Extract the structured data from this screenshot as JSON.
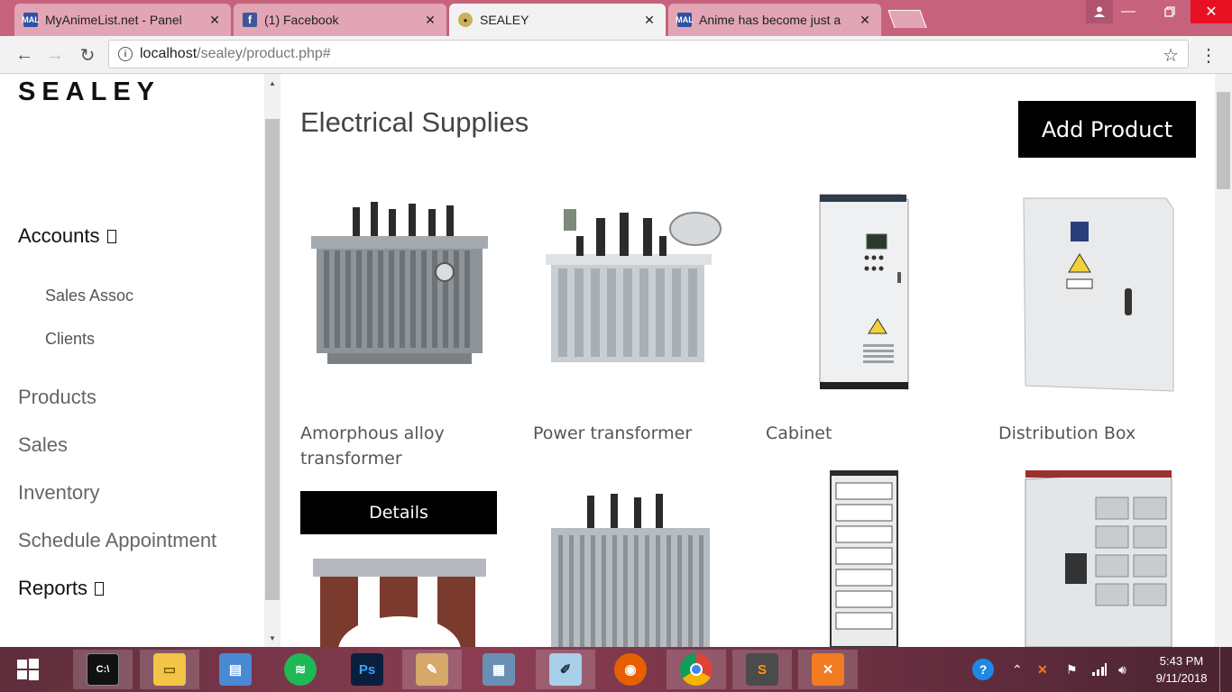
{
  "browser": {
    "tabs": [
      {
        "title": "MyAnimeList.net - Panel",
        "favicon": "mal-icon",
        "active": false
      },
      {
        "title": "(1) Facebook",
        "favicon": "facebook-icon",
        "active": false
      },
      {
        "title": "SEALEY",
        "favicon": "sealey-icon",
        "active": true
      },
      {
        "title": "Anime has become just a",
        "favicon": "mal-icon",
        "active": false
      }
    ],
    "tab_close_glyph": "✕",
    "url_host": "localhost",
    "url_path": "/sealey/product.php#"
  },
  "sidebar": {
    "brand": "SEALEY",
    "accounts": "Accounts",
    "sub_items": [
      "Sales Assoc",
      "Clients"
    ],
    "products": "Products",
    "sales": "Sales",
    "inventory": "Inventory",
    "schedule": "Schedule Appointment",
    "reports": "Reports"
  },
  "main": {
    "title": "Electrical Supplies",
    "add_button": "Add Product",
    "details_button": "Details",
    "products": [
      {
        "name": "Amorphous alloy transformer",
        "image": "transformer-icon"
      },
      {
        "name": "Power transformer",
        "image": "transformer-icon"
      },
      {
        "name": "Cabinet",
        "image": "cabinet-icon"
      },
      {
        "name": "Distribution Box",
        "image": "distribution-box-icon"
      }
    ]
  },
  "taskbar": {
    "time": "5:43 PM",
    "date": "9/11/2018"
  },
  "colors": {
    "tabstrip": "#c7627d",
    "button": "#000000",
    "close": "#e81123"
  }
}
